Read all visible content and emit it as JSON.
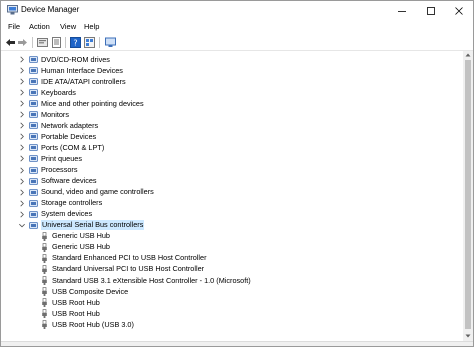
{
  "window": {
    "title": "Device Manager"
  },
  "menu": [
    "File",
    "Action",
    "View",
    "Help"
  ],
  "toolbar": {
    "icons": [
      "back-arrow-icon",
      "forward-arrow-icon",
      "properties-icon",
      "update-driver-icon",
      "help-icon",
      "view-icon",
      "scan-hardware-icon"
    ]
  },
  "tree": {
    "categories": [
      {
        "label": "DVD/CD-ROM drives",
        "icon": "dvd-drive-icon",
        "expanded": false
      },
      {
        "label": "Human Interface Devices",
        "icon": "hid-icon",
        "expanded": false
      },
      {
        "label": "IDE ATA/ATAPI controllers",
        "icon": "ide-controller-icon",
        "expanded": false
      },
      {
        "label": "Keyboards",
        "icon": "keyboard-icon",
        "expanded": false
      },
      {
        "label": "Mice and other pointing devices",
        "icon": "mouse-icon",
        "expanded": false
      },
      {
        "label": "Monitors",
        "icon": "monitor-icon",
        "expanded": false
      },
      {
        "label": "Network adapters",
        "icon": "network-adapter-icon",
        "expanded": false
      },
      {
        "label": "Portable Devices",
        "icon": "portable-device-icon",
        "expanded": false
      },
      {
        "label": "Ports (COM & LPT)",
        "icon": "port-icon",
        "expanded": false
      },
      {
        "label": "Print queues",
        "icon": "printer-icon",
        "expanded": false
      },
      {
        "label": "Processors",
        "icon": "processor-icon",
        "expanded": false
      },
      {
        "label": "Software devices",
        "icon": "software-device-icon",
        "expanded": false
      },
      {
        "label": "Sound, video and game controllers",
        "icon": "sound-icon",
        "expanded": false
      },
      {
        "label": "Storage controllers",
        "icon": "storage-controller-icon",
        "expanded": false
      },
      {
        "label": "System devices",
        "icon": "system-device-icon",
        "expanded": false
      },
      {
        "label": "Universal Serial Bus controllers",
        "icon": "usb-controller-icon",
        "expanded": true,
        "selected": true
      }
    ],
    "usb_children": [
      "Generic USB Hub",
      "Generic USB Hub",
      "Standard Enhanced PCI to USB Host Controller",
      "Standard Universal PCI to USB Host Controller",
      "Standard USB 3.1 eXtensible Host Controller - 1.0 (Microsoft)",
      "USB Composite Device",
      "USB Root Hub",
      "USB Root Hub",
      "USB Root Hub (USB 3.0)"
    ]
  },
  "colors": {
    "selection": "#cce8ff",
    "device_icon": "#4a76b8",
    "usb_plug": "#6e6e6e"
  }
}
